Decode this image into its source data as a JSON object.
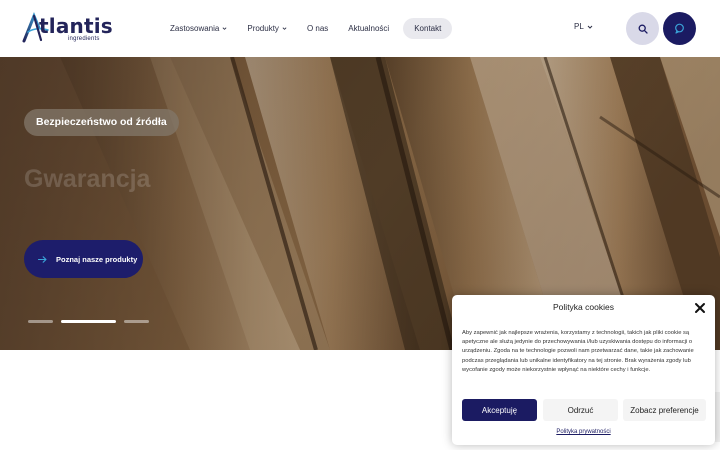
{
  "brand": {
    "name": "tlantis",
    "subtitle": "ingredients",
    "colors": {
      "navy": "#1b1b62",
      "accent_blue": "#3aa3d8",
      "pill_gray": "#e9e9ee"
    }
  },
  "nav": {
    "items": [
      {
        "label": "Zastosowania",
        "has_dropdown": true
      },
      {
        "label": "Produkty",
        "has_dropdown": true
      },
      {
        "label": "O nas",
        "has_dropdown": false
      },
      {
        "label": "Aktualności",
        "has_dropdown": false
      },
      {
        "label": "Kontakt",
        "has_dropdown": false
      }
    ],
    "language": "PL",
    "search_icon": "search-icon",
    "chat_icon": "chat-icon"
  },
  "hero": {
    "badge": "Bezpieczeństwo od źródła",
    "title_faded": "Gwarancja",
    "cta": "Poznaj nasze produkty",
    "slides_total": 3,
    "active_slide": 2
  },
  "cookie": {
    "title": "Polityka cookies",
    "body": "Aby zapewnić jak najlepsze wrażenia, korzystamy z technologii, takich jak pliki cookie są apetyczne ale służą jedynie do przechowywania i/lub uzyskiwania dostępu do informacji o urządzeniu. Zgoda na te technologie pozwoli nam przetwarzać dane, takie jak zachowanie podczas przeglądania lub unikalne identyfikatory na tej stronie. Brak wyrażenia zgody lub wycofanie zgody może niekorzystnie wpłynąć na niektóre cechy i funkcje.",
    "accept": "Akceptuję",
    "deny": "Odrzuć",
    "preferences": "Zobacz preferencje",
    "privacy_link": "Polityka prywatności"
  }
}
